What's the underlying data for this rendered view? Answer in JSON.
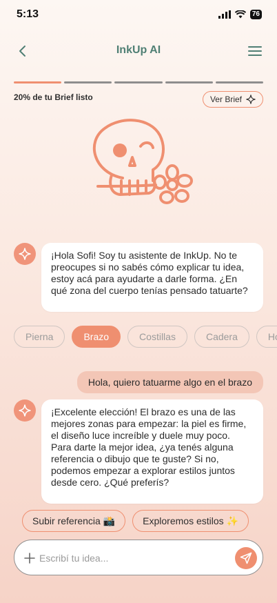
{
  "status": {
    "time": "5:13",
    "battery": "76"
  },
  "nav": {
    "title": "InkUp AI"
  },
  "progress": {
    "label": "20% de tu Brief listo",
    "fraction": 0.2,
    "brief_button": "Ver Brief"
  },
  "messages": {
    "ai_1": "¡Hola Sofi! Soy tu asistente de InkUp. No te preocupes si no sabés cómo explicar tu idea, estoy acá para ayudarte a darle forma. ¿En qué zona del cuerpo tenías pensado tatuarte?",
    "user_1": "Hola, quiero tatuarme algo en el brazo",
    "ai_2": "¡Excelente elección! El brazo es una de las mejores zonas para empezar: la piel es firme, el diseño luce increíble y duele muy poco.\nPara darte la mejor idea, ¿ya tenés alguna referencia o dibujo que te guste? Si no, podemos empezar a explorar estilos juntos desde cero. ¿Qué preferís?"
  },
  "chips": [
    "Pierna",
    "Brazo",
    "Costillas",
    "Cadera",
    "Hombro"
  ],
  "chips_selected": "Brazo",
  "actions": {
    "upload": "Subir referencia 📸",
    "explore": "Exploremos estilos ✨"
  },
  "composer": {
    "placeholder": "Escribí tu idea..."
  },
  "colors": {
    "accent": "#ef8f70",
    "title": "#4f7f74",
    "user_bubble": "#f3c6b6"
  }
}
